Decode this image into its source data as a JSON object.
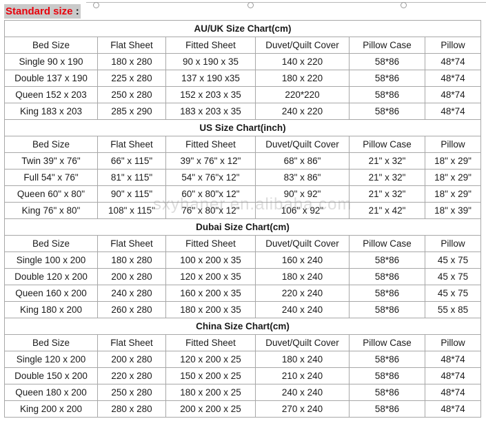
{
  "heading": {
    "label": "Standard size",
    "colon": ":"
  },
  "watermark": "sxyhaner.en.alibaba.com",
  "headers": [
    "Bed Size",
    "Flat Sheet",
    "Fitted Sheet",
    "Duvet/Quilt Cover",
    "Pillow Case",
    "Pillow"
  ],
  "charts": [
    {
      "title": "AU/UK Size Chart(cm)",
      "rows": [
        [
          "Single 90 x 190",
          "180 x 280",
          "90 x 190 x 35",
          "140 x 220",
          "58*86",
          "48*74"
        ],
        [
          "Double 137 x 190",
          "225 x 280",
          "137 x 190 x35",
          "180 x 220",
          "58*86",
          "48*74"
        ],
        [
          "Queen 152 x 203",
          "250 x 280",
          "152 x 203 x 35",
          "220*220",
          "58*86",
          "48*74"
        ],
        [
          "King 183 x 203",
          "285 x 290",
          "183 x 203 x 35",
          "240 x 220",
          "58*86",
          "48*74"
        ]
      ]
    },
    {
      "title": "US Size Chart(inch)",
      "rows": [
        [
          "Twin 39\" x 76\"",
          "66\" x 115\"",
          "39\" x 76\" x 12\"",
          "68\" x 86\"",
          "21\" x 32\"",
          "18\" x 29\""
        ],
        [
          "Full 54\" x 76\"",
          "81\" x 115\"",
          "54\" x 76\"x 12\"",
          "83\" x 86\"",
          "21\" x 32\"",
          "18\" x 29\""
        ],
        [
          "Queen 60\" x 80\"",
          "90\" x 115\"",
          "60\" x 80\"x 12\"",
          "90\" x 92\"",
          "21\" x 32\"",
          "18\" x 29\""
        ],
        [
          "King 76\" x 80\"",
          "108\" x 115\"",
          "76\" x 80\"x 12\"",
          "106\" x 92\"",
          "21\" x 42\"",
          "18\" x 39\""
        ]
      ]
    },
    {
      "title": "Dubai Size Chart(cm)",
      "rows": [
        [
          "Single 100 x 200",
          "180 x 280",
          "100 x 200 x 35",
          "160 x 240",
          "58*86",
          "45 x 75"
        ],
        [
          "Double 120 x 200",
          "200 x 280",
          "120 x 200 x 35",
          "180 x 240",
          "58*86",
          "45 x 75"
        ],
        [
          "Queen 160 x 200",
          "240 x 280",
          "160 x 200 x 35",
          "220 x 240",
          "58*86",
          "45 x 75"
        ],
        [
          "King 180 x 200",
          "260 x 280",
          "180 x 200 x 35",
          "240 x 240",
          "58*86",
          "55 x 85"
        ]
      ]
    },
    {
      "title": "China Size Chart(cm)",
      "rows": [
        [
          "Single 120 x 200",
          "200 x 280",
          "120 x 200 x 25",
          "180 x 240",
          "58*86",
          "48*74"
        ],
        [
          "Double 150 x 200",
          "220 x 280",
          "150 x 200 x 25",
          "210 x 240",
          "58*86",
          "48*74"
        ],
        [
          "Queen 180 x 200",
          "250 x 280",
          "180 x 200 x 25",
          "240 x 240",
          "58*86",
          "48*74"
        ],
        [
          "King 200 x 200",
          "280 x 280",
          "200 x 200 x 25",
          "270 x 240",
          "58*86",
          "48*74"
        ]
      ]
    }
  ]
}
